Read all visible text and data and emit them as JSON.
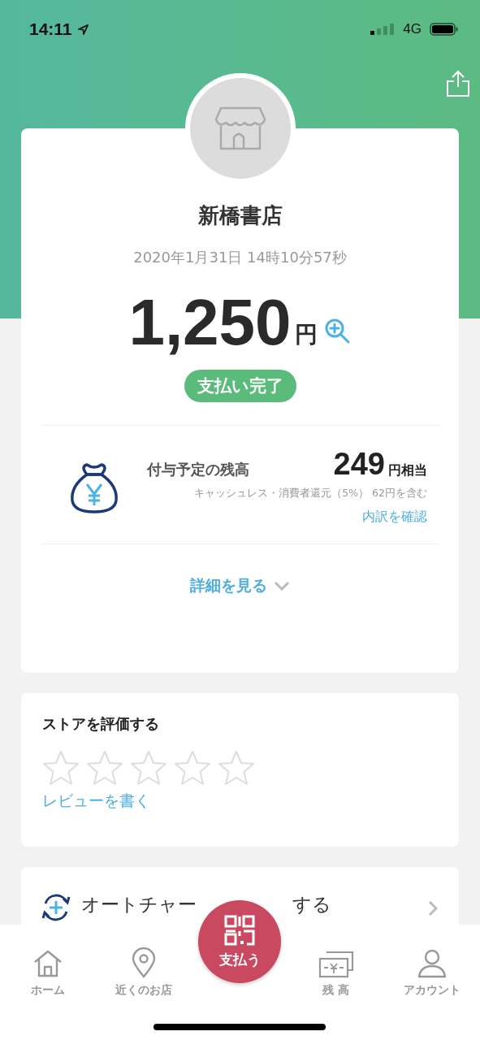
{
  "status_bar": {
    "time": "14:11",
    "network": "4G"
  },
  "store": {
    "name": "新橋書店",
    "datetime": "2020年1月31日 14時10分57秒"
  },
  "payment": {
    "amount": "1,250",
    "unit": "円",
    "status": "支払い完了"
  },
  "reward": {
    "title": "付与予定の残高",
    "amount": "249",
    "unit": "円相当",
    "note": "キャッシュレス・消費者還元（5%） 62円を含む",
    "link": "内訳を確認"
  },
  "details_link": "詳細を見る",
  "rating": {
    "title": "ストアを評価する",
    "stars": 0,
    "review_link": "レビューを書く"
  },
  "auto_charge": {
    "label_start": "オートチャー",
    "label_end": "する"
  },
  "tab_bar": [
    {
      "kind": "home",
      "label": "ホーム",
      "selected": false
    },
    {
      "kind": "pin",
      "label": "近くのお店",
      "selected": false
    },
    {
      "kind": "pay",
      "label": "支払う",
      "selected": false
    },
    {
      "kind": "money",
      "label": "残 高",
      "selected": false
    },
    {
      "kind": "person",
      "label": "アカウント",
      "selected": false
    }
  ]
}
